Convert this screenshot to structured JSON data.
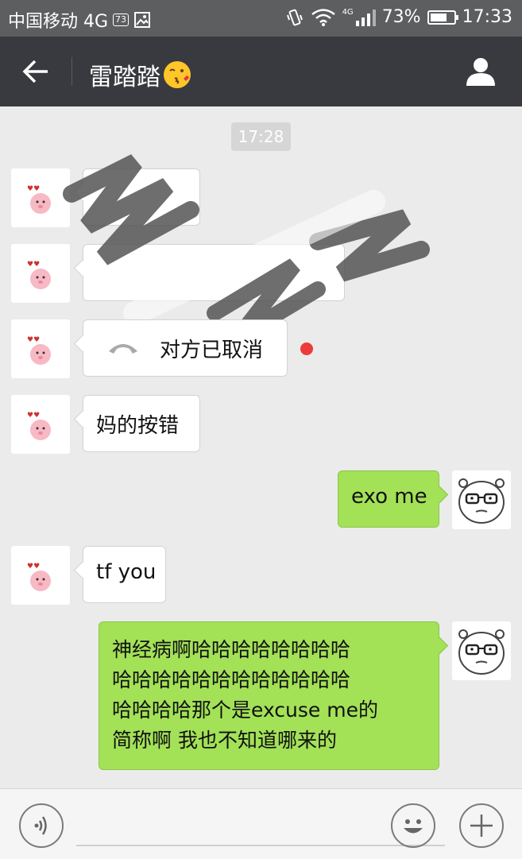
{
  "status_bar": {
    "carrier": "中国移动 4G",
    "sim_badge": "73",
    "network": "4G",
    "battery": "73%",
    "battery_level": 0.73,
    "time": "17:33"
  },
  "header": {
    "title": "雷踏踏"
  },
  "chat": {
    "timestamp": "17:28",
    "call_message": "对方已取消",
    "messages": [
      {
        "direction": "in",
        "text": "妈的按错"
      },
      {
        "direction": "out",
        "text": "exo me"
      },
      {
        "direction": "in",
        "text": "tf you"
      },
      {
        "direction": "out",
        "lines": [
          "神经病啊哈哈哈哈哈哈哈哈",
          "哈哈哈哈哈哈哈哈哈哈哈哈",
          "哈哈哈哈那个是excuse me的",
          "简称啊 我也不知道哪来的"
        ]
      }
    ]
  },
  "colors": {
    "header_bg": "#393a3f",
    "status_bg": "#5c5e5f",
    "chat_bg": "#ebebeb",
    "outgoing_bubble": "#a3e157",
    "incoming_bubble": "#ffffff",
    "unread_dot": "#ee3a3a"
  }
}
